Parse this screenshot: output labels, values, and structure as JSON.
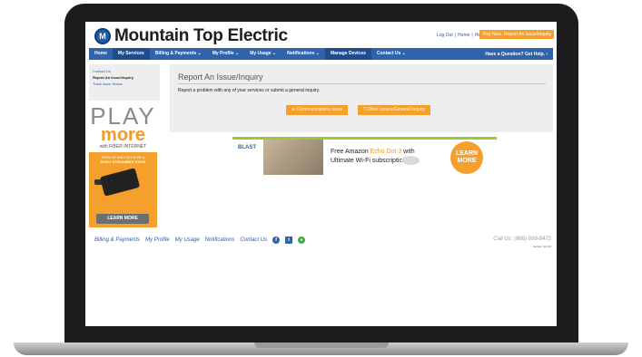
{
  "brand": {
    "name": "Mountain Top Electric"
  },
  "header": {
    "links": [
      "Log Out",
      "Home",
      "Help"
    ],
    "pay_now": "Pay Now ›",
    "report_button": "Report An Issue/Inquiry"
  },
  "nav": {
    "items": [
      "Home",
      "My Services",
      "Billing & Payments ⌄",
      "My Profile ⌄",
      "My Usage ⌄",
      "Notifications ⌄",
      "Manage Devices",
      "Contact Us ⌄"
    ],
    "help": "Have a Question? Get Help. ›"
  },
  "sidebar": {
    "items": [
      "Contact Us",
      "Report An Issue/Inquiry",
      "Track Issue Status"
    ]
  },
  "promo": {
    "play": "PLAY",
    "more": "more",
    "fiber": "with FIBER INTERNET",
    "signup": "SIGN UP AND RECEIVE A",
    "roku": "ROKU STREAMING STICK",
    "learn_more": "LEARN MORE"
  },
  "main": {
    "title": "Report An Issue/Inquiry",
    "description": "Report a problem with any of your services or submit a general inquiry.",
    "comm_button": "Communications Issue",
    "other_button": "Other Issues/General Inquiry"
  },
  "banner": {
    "blast": "BLAST",
    "line1_pre": "Free Amazon ",
    "line1_highlight": "Echo Dot 3",
    "line1_post": " with",
    "line2": "Ultimate Wi-Fi subscription",
    "learn": "LEARN",
    "more": "MORE"
  },
  "footer": {
    "links": [
      "Billing & Payments",
      "My Profile",
      "My Usage",
      "Notifications",
      "Contact Us"
    ],
    "call": "Call Us: (866) 999-8472",
    "version": "Version: 10.0.0"
  },
  "colors": {
    "accent": "#f5a02d",
    "nav": "#2f63ad",
    "link": "#2a5db0"
  }
}
